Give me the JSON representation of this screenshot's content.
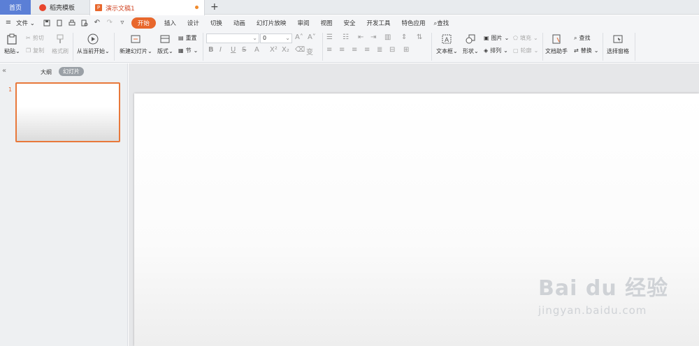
{
  "tabs": {
    "home": "首页",
    "template": "稻壳模板",
    "document": "演示文稿1"
  },
  "menu": {
    "file": "文件",
    "items": [
      "开始",
      "插入",
      "设计",
      "切换",
      "动画",
      "幻灯片放映",
      "审阅",
      "视图",
      "安全",
      "开发工具",
      "特色应用"
    ],
    "active": "开始",
    "search": "查找"
  },
  "ribbon": {
    "paste": "粘贴",
    "cut": "剪切",
    "copy": "复制",
    "format_painter": "格式刷",
    "from_current": "从当前开始",
    "new_slide": "新建幻灯片",
    "layout": "版式",
    "reset": "重置",
    "section": "节",
    "font_name": "",
    "font_size": "0",
    "text_box": "文本框",
    "shape": "形状",
    "picture": "图片",
    "arrange": "排列",
    "fill": "填充",
    "outline": "轮廓",
    "doc_helper": "文档助手",
    "find": "查找",
    "replace": "替换",
    "selection_pane": "选择窗格"
  },
  "sidebar": {
    "outline_tab": "大纲",
    "slides_tab": "幻灯片",
    "slide_number": "1"
  },
  "watermark": {
    "brand": "Bai du 经验",
    "url": "jingyan.baidu.com"
  }
}
